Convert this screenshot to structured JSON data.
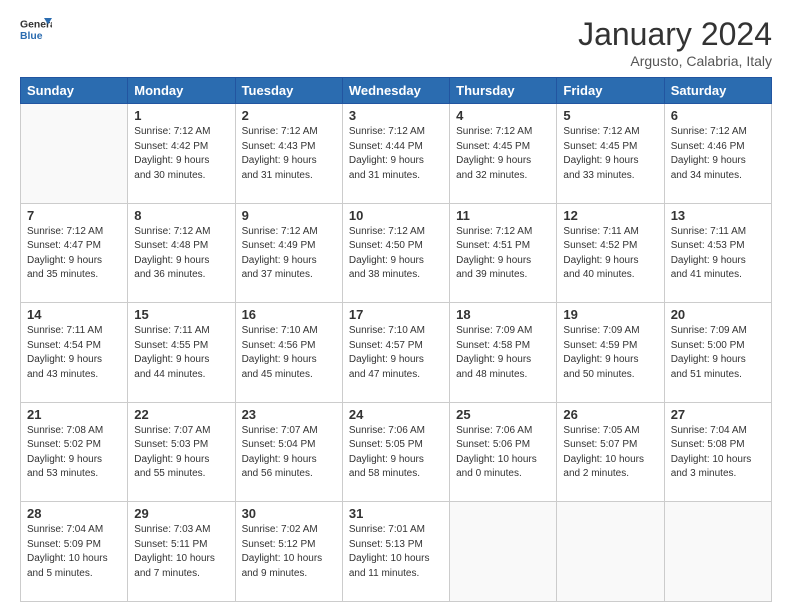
{
  "logo": {
    "line1": "General",
    "line2": "Blue"
  },
  "title": "January 2024",
  "subtitle": "Argusto, Calabria, Italy",
  "days_of_week": [
    "Sunday",
    "Monday",
    "Tuesday",
    "Wednesday",
    "Thursday",
    "Friday",
    "Saturday"
  ],
  "weeks": [
    [
      {
        "day": "",
        "info": ""
      },
      {
        "day": "1",
        "info": "Sunrise: 7:12 AM\nSunset: 4:42 PM\nDaylight: 9 hours\nand 30 minutes."
      },
      {
        "day": "2",
        "info": "Sunrise: 7:12 AM\nSunset: 4:43 PM\nDaylight: 9 hours\nand 31 minutes."
      },
      {
        "day": "3",
        "info": "Sunrise: 7:12 AM\nSunset: 4:44 PM\nDaylight: 9 hours\nand 31 minutes."
      },
      {
        "day": "4",
        "info": "Sunrise: 7:12 AM\nSunset: 4:45 PM\nDaylight: 9 hours\nand 32 minutes."
      },
      {
        "day": "5",
        "info": "Sunrise: 7:12 AM\nSunset: 4:45 PM\nDaylight: 9 hours\nand 33 minutes."
      },
      {
        "day": "6",
        "info": "Sunrise: 7:12 AM\nSunset: 4:46 PM\nDaylight: 9 hours\nand 34 minutes."
      }
    ],
    [
      {
        "day": "7",
        "info": "Sunrise: 7:12 AM\nSunset: 4:47 PM\nDaylight: 9 hours\nand 35 minutes."
      },
      {
        "day": "8",
        "info": "Sunrise: 7:12 AM\nSunset: 4:48 PM\nDaylight: 9 hours\nand 36 minutes."
      },
      {
        "day": "9",
        "info": "Sunrise: 7:12 AM\nSunset: 4:49 PM\nDaylight: 9 hours\nand 37 minutes."
      },
      {
        "day": "10",
        "info": "Sunrise: 7:12 AM\nSunset: 4:50 PM\nDaylight: 9 hours\nand 38 minutes."
      },
      {
        "day": "11",
        "info": "Sunrise: 7:12 AM\nSunset: 4:51 PM\nDaylight: 9 hours\nand 39 minutes."
      },
      {
        "day": "12",
        "info": "Sunrise: 7:11 AM\nSunset: 4:52 PM\nDaylight: 9 hours\nand 40 minutes."
      },
      {
        "day": "13",
        "info": "Sunrise: 7:11 AM\nSunset: 4:53 PM\nDaylight: 9 hours\nand 41 minutes."
      }
    ],
    [
      {
        "day": "14",
        "info": "Sunrise: 7:11 AM\nSunset: 4:54 PM\nDaylight: 9 hours\nand 43 minutes."
      },
      {
        "day": "15",
        "info": "Sunrise: 7:11 AM\nSunset: 4:55 PM\nDaylight: 9 hours\nand 44 minutes."
      },
      {
        "day": "16",
        "info": "Sunrise: 7:10 AM\nSunset: 4:56 PM\nDaylight: 9 hours\nand 45 minutes."
      },
      {
        "day": "17",
        "info": "Sunrise: 7:10 AM\nSunset: 4:57 PM\nDaylight: 9 hours\nand 47 minutes."
      },
      {
        "day": "18",
        "info": "Sunrise: 7:09 AM\nSunset: 4:58 PM\nDaylight: 9 hours\nand 48 minutes."
      },
      {
        "day": "19",
        "info": "Sunrise: 7:09 AM\nSunset: 4:59 PM\nDaylight: 9 hours\nand 50 minutes."
      },
      {
        "day": "20",
        "info": "Sunrise: 7:09 AM\nSunset: 5:00 PM\nDaylight: 9 hours\nand 51 minutes."
      }
    ],
    [
      {
        "day": "21",
        "info": "Sunrise: 7:08 AM\nSunset: 5:02 PM\nDaylight: 9 hours\nand 53 minutes."
      },
      {
        "day": "22",
        "info": "Sunrise: 7:07 AM\nSunset: 5:03 PM\nDaylight: 9 hours\nand 55 minutes."
      },
      {
        "day": "23",
        "info": "Sunrise: 7:07 AM\nSunset: 5:04 PM\nDaylight: 9 hours\nand 56 minutes."
      },
      {
        "day": "24",
        "info": "Sunrise: 7:06 AM\nSunset: 5:05 PM\nDaylight: 9 hours\nand 58 minutes."
      },
      {
        "day": "25",
        "info": "Sunrise: 7:06 AM\nSunset: 5:06 PM\nDaylight: 10 hours\nand 0 minutes."
      },
      {
        "day": "26",
        "info": "Sunrise: 7:05 AM\nSunset: 5:07 PM\nDaylight: 10 hours\nand 2 minutes."
      },
      {
        "day": "27",
        "info": "Sunrise: 7:04 AM\nSunset: 5:08 PM\nDaylight: 10 hours\nand 3 minutes."
      }
    ],
    [
      {
        "day": "28",
        "info": "Sunrise: 7:04 AM\nSunset: 5:09 PM\nDaylight: 10 hours\nand 5 minutes."
      },
      {
        "day": "29",
        "info": "Sunrise: 7:03 AM\nSunset: 5:11 PM\nDaylight: 10 hours\nand 7 minutes."
      },
      {
        "day": "30",
        "info": "Sunrise: 7:02 AM\nSunset: 5:12 PM\nDaylight: 10 hours\nand 9 minutes."
      },
      {
        "day": "31",
        "info": "Sunrise: 7:01 AM\nSunset: 5:13 PM\nDaylight: 10 hours\nand 11 minutes."
      },
      {
        "day": "",
        "info": ""
      },
      {
        "day": "",
        "info": ""
      },
      {
        "day": "",
        "info": ""
      }
    ]
  ]
}
